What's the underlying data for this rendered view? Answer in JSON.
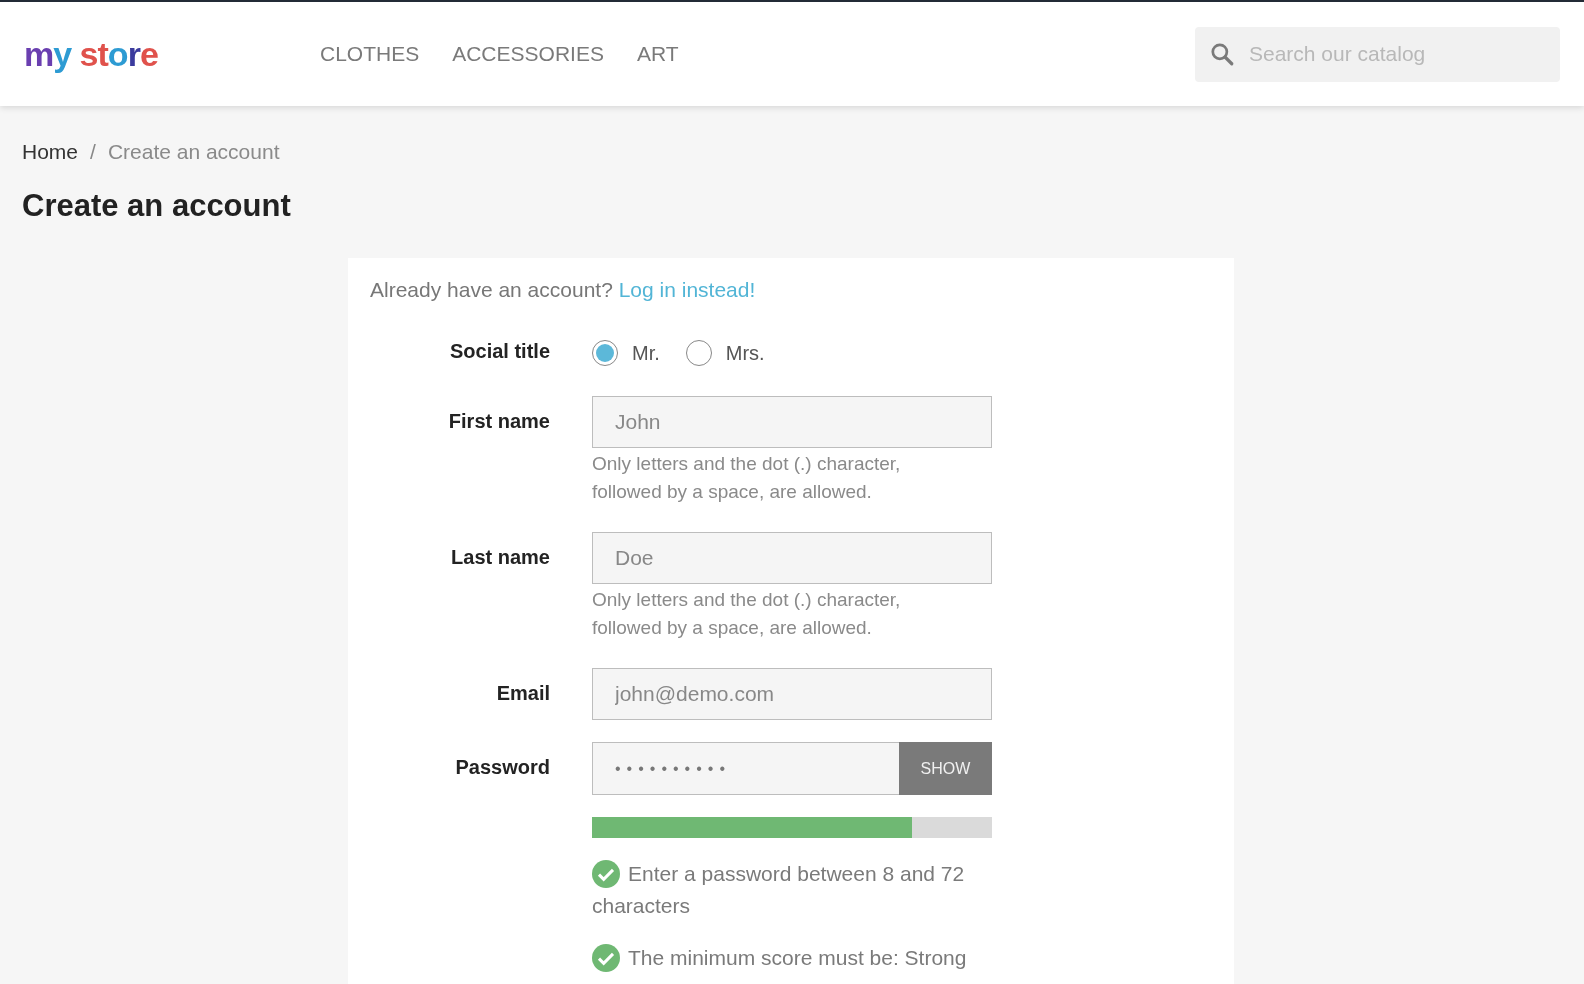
{
  "header": {
    "logo": "my store",
    "nav": [
      "CLOTHES",
      "ACCESSORIES",
      "ART"
    ],
    "search": {
      "placeholder": "Search our catalog"
    }
  },
  "breadcrumb": [
    "Home",
    "Create an account"
  ],
  "breadcrumb_separator": "/",
  "title": "Create an account",
  "form": {
    "login_prompt": "Already have an account?",
    "login_link": "Log in instead!",
    "social_title": {
      "label": "Social title",
      "options": [
        {
          "label": "Mr.",
          "selected": true
        },
        {
          "label": "Mrs.",
          "selected": false
        }
      ]
    },
    "fields": [
      {
        "label": "First name",
        "value": "John",
        "hint": "Only letters and the dot (.) character, followed by a space, are allowed."
      },
      {
        "label": "Last name",
        "value": "Doe",
        "hint": "Only letters and the dot (.) character, followed by a space, are allowed."
      },
      {
        "label": "Email",
        "value": "john@demo.com"
      }
    ],
    "password": {
      "label": "Password",
      "value": "••••••••••",
      "button": "SHOW",
      "level": 0.8
    },
    "rules": [
      {
        "text": "Enter a password between 8 and 72 characters",
        "checked": true
      },
      {
        "text": "The minimum score must be: Strong",
        "checked": true
      }
    ]
  }
}
